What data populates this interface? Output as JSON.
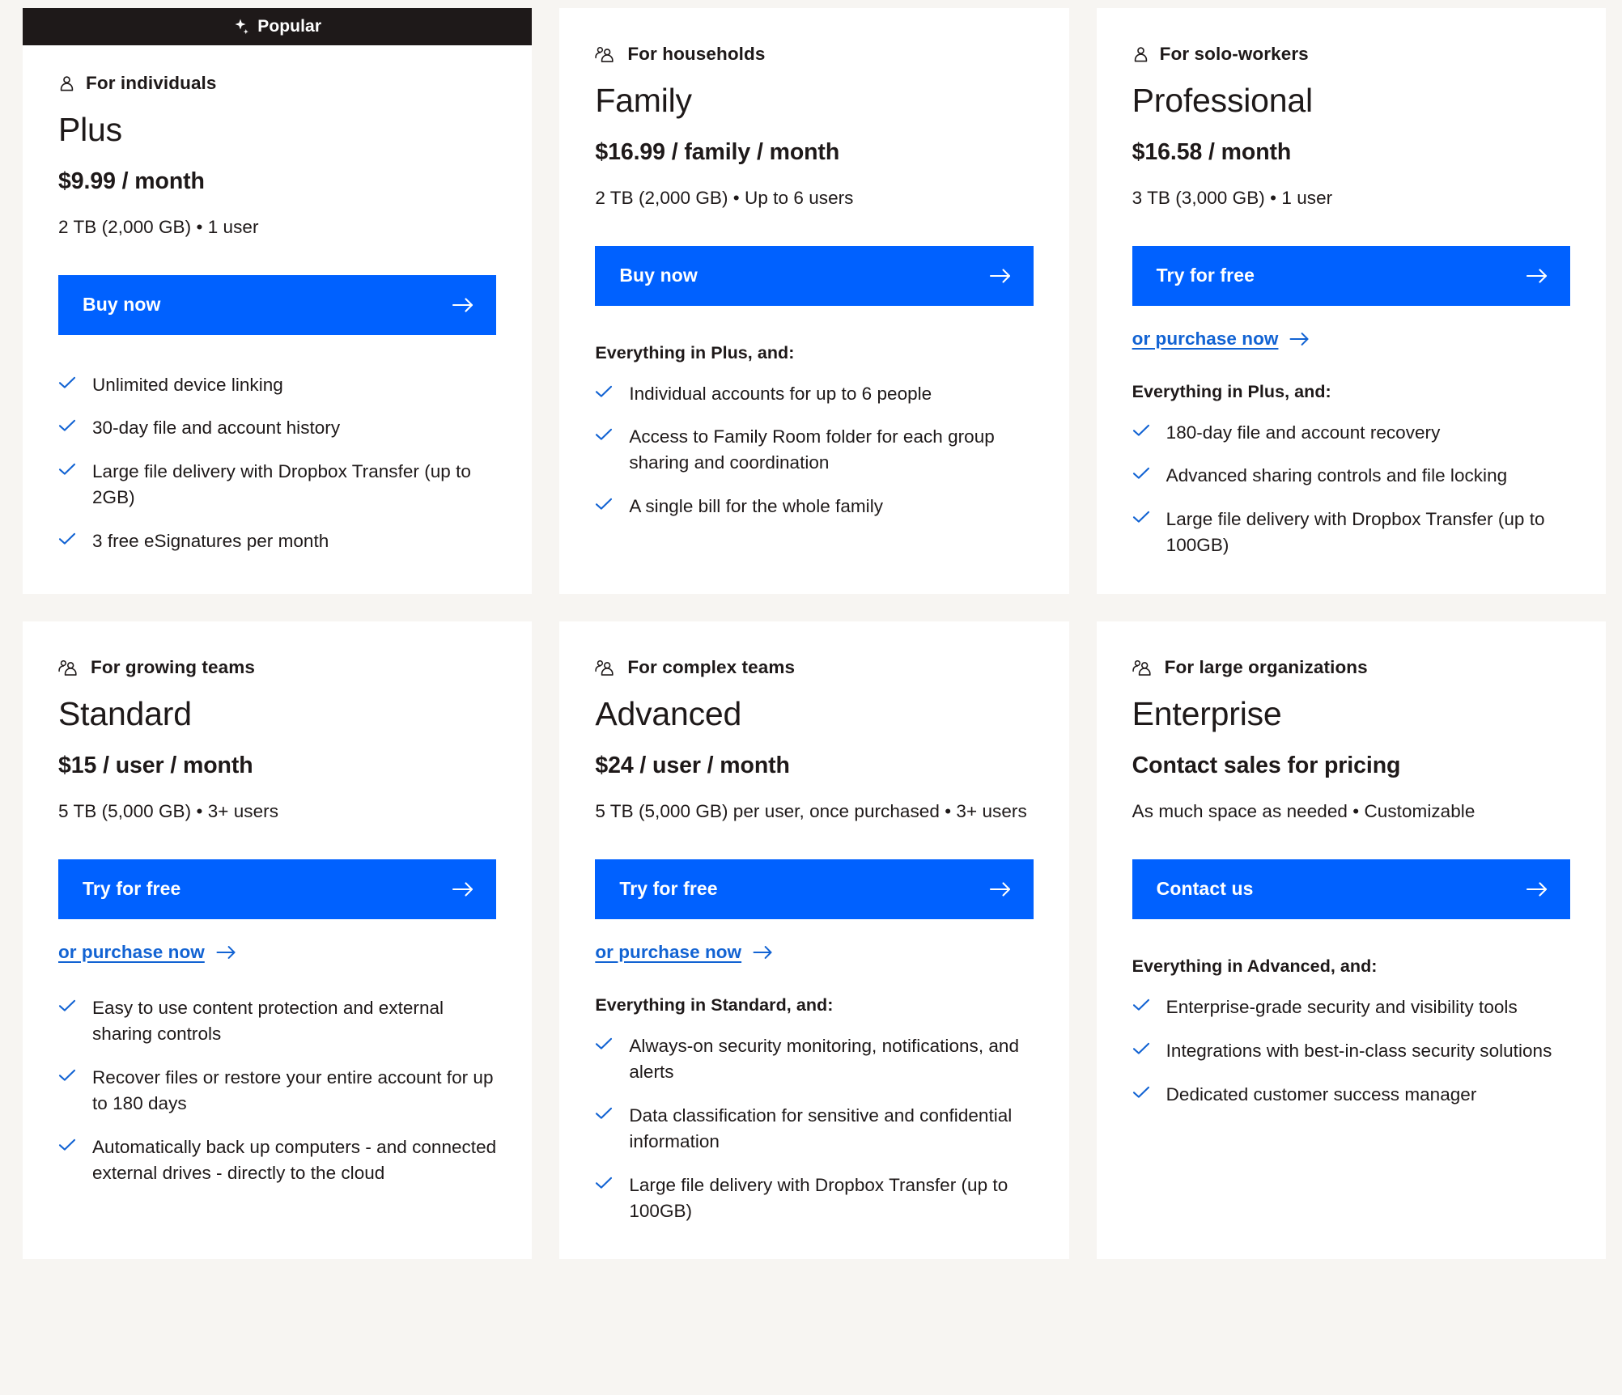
{
  "colors": {
    "page_background": "#f7f5f2",
    "card_background": "#ffffff",
    "badge_background": "#1e1919",
    "accent_blue": "#0061ff",
    "link_blue": "#1263d3",
    "text": "#1e1919"
  },
  "badge": {
    "label": "Popular",
    "icon": "sparkle-icon"
  },
  "plans": [
    {
      "id": "plus",
      "popular": true,
      "audience": "For individuals",
      "audience_icon": "single-person-icon",
      "name": "Plus",
      "price": "$9.99 / month",
      "capacity": "2 TB (2,000 GB) • 1 user",
      "cta_label": "Buy now",
      "cta_icon": "arrow-right-icon",
      "secondary_link": null,
      "features_heading": null,
      "features": [
        "Unlimited device linking",
        "30-day file and account history",
        "Large file delivery with Dropbox Transfer (up to 2GB)",
        "3 free eSignatures per month"
      ]
    },
    {
      "id": "family",
      "popular": false,
      "audience": "For households",
      "audience_icon": "two-people-icon",
      "name": "Family",
      "price": "$16.99 / family / month",
      "capacity": "2 TB (2,000 GB) • Up to 6 users",
      "cta_label": "Buy now",
      "cta_icon": "arrow-right-icon",
      "secondary_link": null,
      "features_heading": "Everything in Plus, and:",
      "features": [
        "Individual accounts for up to 6 people",
        "Access to Family Room folder for each group sharing and coordination",
        "A single bill for the whole family"
      ]
    },
    {
      "id": "professional",
      "popular": false,
      "audience": "For solo-workers",
      "audience_icon": "single-person-icon",
      "name": "Professional",
      "price": "$16.58 / month",
      "capacity": "3 TB (3,000 GB) • 1 user",
      "cta_label": "Try for free",
      "cta_icon": "arrow-right-icon",
      "secondary_link": "or purchase now",
      "features_heading": "Everything in Plus, and:",
      "features": [
        "180-day file and account recovery",
        "Advanced sharing controls and file locking",
        "Large file delivery with Dropbox Transfer (up to 100GB)"
      ]
    },
    {
      "id": "standard",
      "popular": false,
      "audience": "For growing teams",
      "audience_icon": "two-people-icon",
      "name": "Standard",
      "price": "$15 / user / month",
      "capacity": "5 TB (5,000 GB) • 3+ users",
      "cta_label": "Try for free",
      "cta_icon": "arrow-right-icon",
      "secondary_link": "or purchase now",
      "features_heading": null,
      "features": [
        "Easy to use content protection and external sharing controls",
        "Recover files or restore your entire account for up to 180 days",
        "Automatically back up computers - and connected external drives - directly to the cloud"
      ]
    },
    {
      "id": "advanced",
      "popular": false,
      "audience": "For complex teams",
      "audience_icon": "two-people-icon",
      "name": "Advanced",
      "price": "$24 / user / month",
      "capacity": "5 TB (5,000 GB) per user, once purchased • 3+ users",
      "cta_label": "Try for free",
      "cta_icon": "arrow-right-icon",
      "secondary_link": "or purchase now",
      "features_heading": "Everything in Standard, and:",
      "features": [
        "Always-on security monitoring, notifications, and alerts",
        "Data classification for sensitive and confidential information",
        "Large file delivery with Dropbox Transfer (up to 100GB)"
      ]
    },
    {
      "id": "enterprise",
      "popular": false,
      "audience": "For large organizations",
      "audience_icon": "two-people-icon",
      "name": "Enterprise",
      "price": "Contact sales for pricing",
      "capacity": "As much space as needed • Customizable",
      "cta_label": "Contact us",
      "cta_icon": "arrow-right-icon",
      "secondary_link": null,
      "features_heading": "Everything in Advanced, and:",
      "features": [
        "Enterprise-grade security and visibility tools",
        "Integrations with best-in-class security solutions",
        "Dedicated customer success manager"
      ]
    }
  ]
}
